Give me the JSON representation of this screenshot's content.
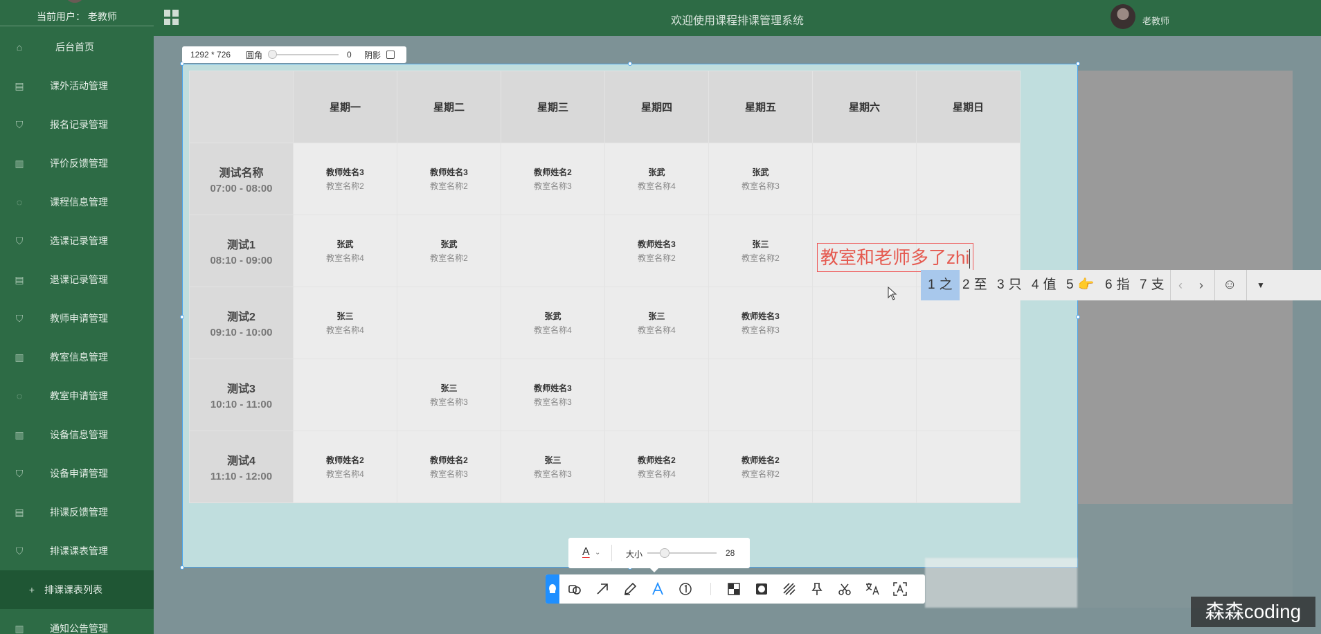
{
  "sidebar": {
    "current_user": "当前用户： 老教师",
    "items": [
      {
        "label": "后台首页",
        "icon": "home-icon"
      },
      {
        "label": "课外活动管理",
        "icon": "document-icon"
      },
      {
        "label": "报名记录管理",
        "icon": "shield-check-icon"
      },
      {
        "label": "评价反馈管理",
        "icon": "columns-icon"
      },
      {
        "label": "课程信息管理",
        "icon": "chat-icon"
      },
      {
        "label": "选课记录管理",
        "icon": "shield-check-icon"
      },
      {
        "label": "退课记录管理",
        "icon": "document-icon"
      },
      {
        "label": "教师申请管理",
        "icon": "shield-check-icon"
      },
      {
        "label": "教室信息管理",
        "icon": "columns-icon"
      },
      {
        "label": "教室申请管理",
        "icon": "chat-icon"
      },
      {
        "label": "设备信息管理",
        "icon": "columns-icon"
      },
      {
        "label": "设备申请管理",
        "icon": "shield-check-icon"
      },
      {
        "label": "排课反馈管理",
        "icon": "document-icon"
      },
      {
        "label": "排课课表管理",
        "icon": "shield-check-icon"
      },
      {
        "label": "排课课表列表",
        "icon": "plus-icon"
      },
      {
        "label": "通知公告管理",
        "icon": "columns-icon"
      }
    ]
  },
  "header": {
    "title": "欢迎使用课程排课管理系统",
    "user_name": "老教师"
  },
  "capture": {
    "dimensions": "1292 * 726",
    "corner_label": "圆角",
    "corner_value": "0",
    "shadow_label": "阴影"
  },
  "schedule": {
    "days": [
      "星期一",
      "星期二",
      "星期三",
      "星期四",
      "星期五",
      "星期六",
      "星期日"
    ],
    "rows": [
      {
        "name": "测试名称",
        "time": "07:00 - 08:00",
        "cells": [
          {
            "teacher": "教师姓名3",
            "room": "教室名称2"
          },
          {
            "teacher": "教师姓名3",
            "room": "教室名称2"
          },
          {
            "teacher": "教师姓名2",
            "room": "教室名称3"
          },
          {
            "teacher": "张武",
            "room": "教室名称4"
          },
          {
            "teacher": "张武",
            "room": "教室名称3"
          },
          {
            "teacher": "",
            "room": ""
          },
          {
            "teacher": "",
            "room": ""
          }
        ]
      },
      {
        "name": "测试1",
        "time": "08:10 - 09:00",
        "cells": [
          {
            "teacher": "张武",
            "room": "教室名称4"
          },
          {
            "teacher": "张武",
            "room": "教室名称2"
          },
          {
            "teacher": "",
            "room": ""
          },
          {
            "teacher": "教师姓名3",
            "room": "教室名称2"
          },
          {
            "teacher": "张三",
            "room": "教室名称2"
          },
          {
            "teacher": "",
            "room": ""
          },
          {
            "teacher": "",
            "room": ""
          }
        ]
      },
      {
        "name": "测试2",
        "time": "09:10 - 10:00",
        "cells": [
          {
            "teacher": "张三",
            "room": "教室名称4"
          },
          {
            "teacher": "",
            "room": ""
          },
          {
            "teacher": "张武",
            "room": "教室名称4"
          },
          {
            "teacher": "张三",
            "room": "教室名称4"
          },
          {
            "teacher": "教师姓名3",
            "room": "教室名称3"
          },
          {
            "teacher": "",
            "room": ""
          },
          {
            "teacher": "",
            "room": ""
          }
        ]
      },
      {
        "name": "测试3",
        "time": "10:10 - 11:00",
        "cells": [
          {
            "teacher": "",
            "room": ""
          },
          {
            "teacher": "张三",
            "room": "教室名称3"
          },
          {
            "teacher": "教师姓名3",
            "room": "教室名称3"
          },
          {
            "teacher": "",
            "room": ""
          },
          {
            "teacher": "",
            "room": ""
          },
          {
            "teacher": "",
            "room": ""
          },
          {
            "teacher": "",
            "room": ""
          }
        ]
      },
      {
        "name": "测试4",
        "time": "11:10 - 12:00",
        "cells": [
          {
            "teacher": "教师姓名2",
            "room": "教室名称4"
          },
          {
            "teacher": "教师姓名2",
            "room": "教室名称3"
          },
          {
            "teacher": "张三",
            "room": "教室名称3"
          },
          {
            "teacher": "教师姓名2",
            "room": "教室名称4"
          },
          {
            "teacher": "教师姓名2",
            "room": "教室名称2"
          },
          {
            "teacher": "",
            "room": ""
          },
          {
            "teacher": "",
            "room": ""
          }
        ]
      }
    ]
  },
  "annotation": {
    "text": "教室和老师多了zhi",
    "color": "#e55a50"
  },
  "ime": {
    "candidates": [
      {
        "num": "1",
        "text": "之"
      },
      {
        "num": "2",
        "text": "至"
      },
      {
        "num": "3",
        "text": "只"
      },
      {
        "num": "4",
        "text": "值"
      },
      {
        "num": "5",
        "text": "👉"
      },
      {
        "num": "6",
        "text": "指"
      },
      {
        "num": "7",
        "text": "支"
      }
    ],
    "prev": "‹",
    "next": "›",
    "emoji": "☺",
    "more": "▼"
  },
  "font_toolbar": {
    "font_icon": "A",
    "size_label": "大小",
    "size_value": "28"
  },
  "main_toolbar": {
    "tools": [
      "pin-icon",
      "shape-icon",
      "arrow-icon",
      "pen-icon",
      "text-icon",
      "number-icon",
      "mosaic-icon",
      "blur-icon",
      "hatch-icon",
      "pin-top-icon",
      "scissors-icon",
      "translate-icon",
      "ocr-icon"
    ]
  },
  "watermark": "森森coding",
  "accent": "#2d6b45"
}
